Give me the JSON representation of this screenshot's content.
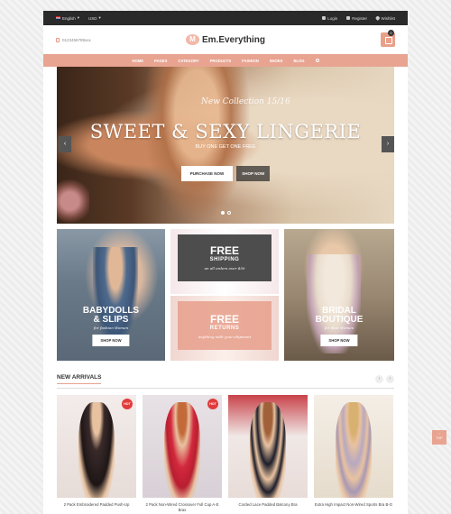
{
  "topbar": {
    "language": "English",
    "currency": "USD",
    "login": "Login",
    "register": "Register",
    "wishlist": "Wishlist"
  },
  "header": {
    "phone": "0123456789xxx",
    "logo_mark": "M",
    "logo_text": "Em.Everything",
    "cart_count": "0"
  },
  "nav": [
    "HOME",
    "PAGES",
    "CATEGORY",
    "PRODUCTS",
    "FASHION",
    "SHOES",
    "BLOG"
  ],
  "hero": {
    "script": "New Collection 15/16",
    "title": "SWEET & SEXY LINGERIE",
    "subtitle": "BUY ONE GET ONE FREE",
    "btn_primary": "PURCHASE NOW",
    "btn_secondary": "SHOP NOW",
    "prev": "‹",
    "next": "›"
  },
  "banners": {
    "babydolls": {
      "line1": "BABYDOLLS",
      "line2": "& SLIPS",
      "small": "for fashion Women",
      "btn": "SHOP NOW"
    },
    "shipping": {
      "title": "FREE",
      "sub": "SHIPPING",
      "small": "on all orders over $50"
    },
    "returns": {
      "title": "FREE",
      "sub": "RETURNS",
      "small": "anything with your shipment"
    },
    "bridal": {
      "line1": "BRIDAL",
      "line2": "BOUTIQUE",
      "small": "for Best Women",
      "btn": "SHOP NOW"
    }
  },
  "new_arrivals": {
    "title": "NEW ARRIVALS",
    "prev": "‹",
    "next": "›",
    "products": [
      {
        "name": "2 Pack Embroidered Padded Push-Up",
        "hot": "HOT"
      },
      {
        "name": "2 Pack Non-Wired Crossover Full Cup A-E Bras",
        "hot": "HOT"
      },
      {
        "name": "Corded Lace Padded Balcony Bra",
        "hot": ""
      },
      {
        "name": "Extra High Impact Non-Wired Sports Bra B-G",
        "hot": ""
      }
    ]
  },
  "to_top": "TOP",
  "colors": {
    "accent": "#e8a491",
    "dark": "#2a2a2a",
    "hot": "#e23b3b"
  }
}
